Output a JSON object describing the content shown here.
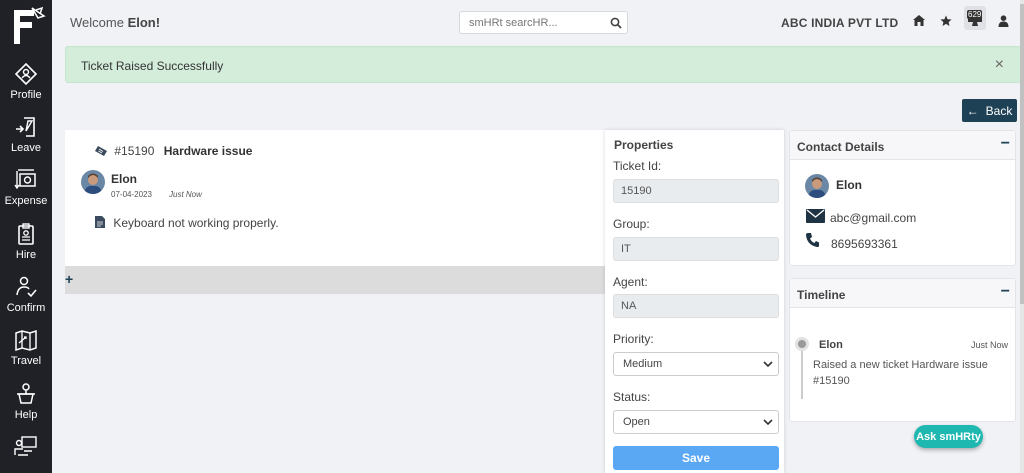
{
  "sidebar": {
    "logo_icon": "brand-logo-icon",
    "items": [
      {
        "label": "Profile",
        "icon": "profile-icon"
      },
      {
        "label": "Leave",
        "icon": "leave-icon"
      },
      {
        "label": "Expense",
        "icon": "expense-icon"
      },
      {
        "label": "Hire",
        "icon": "hire-icon"
      },
      {
        "label": "Confirm",
        "icon": "confirm-icon"
      },
      {
        "label": "Travel",
        "icon": "travel-icon"
      },
      {
        "label": "Help",
        "icon": "help-icon"
      }
    ]
  },
  "header": {
    "welcome_prefix": "Welcome",
    "user_name": "Elon!",
    "search_placeholder": "smHRt searcHR...",
    "company": "ABC INDIA PVT LTD",
    "badge_count": "629"
  },
  "alert": {
    "message": "Ticket Raised Successfully",
    "close": "×"
  },
  "back_label": "Back",
  "ticket": {
    "number": "#15190",
    "subject": "Hardware issue",
    "user": "Elon",
    "date": "07-04-2023",
    "time": "Just Now",
    "description": "Keyboard not working properly.",
    "reply_plus": "+"
  },
  "properties": {
    "title": "Properties",
    "ticket_id_label": "Ticket Id:",
    "ticket_id": "15190",
    "group_label": "Group:",
    "group": "IT",
    "agent_label": "Agent:",
    "agent": "NA",
    "priority_label": "Priority:",
    "priority": "Medium",
    "status_label": "Status:",
    "status": "Open",
    "save_label": "Save"
  },
  "contact": {
    "title": "Contact Details",
    "name": "Elon",
    "email": "abc@gmail.com",
    "phone": "8695693361",
    "minimize": "−"
  },
  "timeline": {
    "title": "Timeline",
    "user": "Elon",
    "time": "Just Now",
    "text": "Raised a new ticket Hardware issue #15190",
    "minimize": "−"
  },
  "ask_label": "Ask smHRty",
  "colors": {
    "sidebar_bg": "#1f2126",
    "accent": "#1e4156",
    "alert_bg": "#d4eddb",
    "save_bg": "#5aa7f3",
    "ask_bg": "#1fb8b0"
  }
}
